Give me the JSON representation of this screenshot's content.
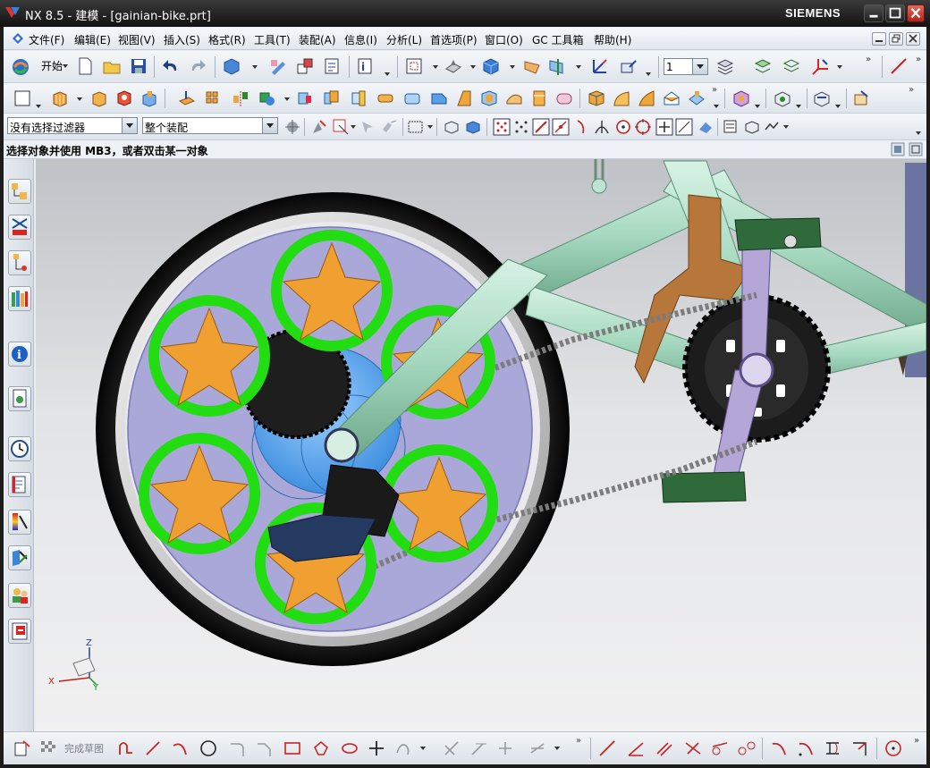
{
  "window": {
    "title": "NX 8.5 - 建模 - [gainian-bike.prt]",
    "brand": "SIEMENS",
    "controls": [
      "minimize-icon",
      "maximize-icon",
      "close-icon"
    ]
  },
  "menubar": {
    "items": [
      "文件(F)",
      "编辑(E)",
      "视图(V)",
      "插入(S)",
      "格式(R)",
      "工具(T)",
      "装配(A)",
      "信息(I)",
      "分析(L)",
      "首选项(P)",
      "窗口(O)",
      "GC 工具箱",
      "帮助(H)"
    ]
  },
  "standard_toolbar": {
    "start_label": "开始",
    "layer_value": "1"
  },
  "selection_bar": {
    "type_filter": "没有选择过滤器",
    "scope": "整个装配"
  },
  "cue_line": "选择对象并使用 MB3，或者双击某一对象",
  "bottom_toolbar": {
    "finish_sketch_label": "完成草图"
  },
  "triad": {
    "x": "X",
    "y": "Y",
    "z": "Z"
  },
  "colors": {
    "title_bar": "#1a1a1a",
    "frame_green": "#aee0cb",
    "star_gold": "#f0a030",
    "ring_green": "#22dd11",
    "disc_lavender": "#a9a8d9",
    "chainring_black": "#1c1c1c",
    "crank_lavender": "#b4a6d6",
    "derailleur_copper": "#b8773a",
    "pedal_green": "#2f6b3a"
  }
}
